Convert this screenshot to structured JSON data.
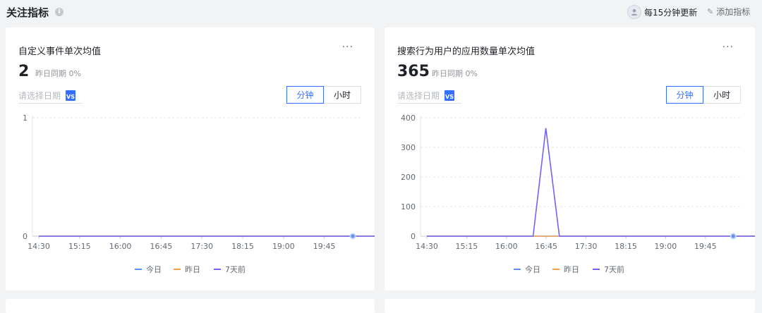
{
  "header": {
    "title": "关注指标",
    "info_icon": "info-icon",
    "refresh_text": "每15分钟更新",
    "add_label": "添加指标"
  },
  "cards": [
    {
      "title": "自定义事件单次均值",
      "value": "2",
      "compare": "昨日同期  0%",
      "date_placeholder": "请选择日期",
      "seg_minute": "分钟",
      "seg_hour": "小时"
    },
    {
      "title": "搜索行为用户的应用数量单次均值",
      "value": "365",
      "compare": "昨日同期  0%",
      "date_placeholder": "请选择日期",
      "seg_minute": "分钟",
      "seg_hour": "小时"
    }
  ],
  "chart_data": [
    {
      "type": "line",
      "title": "",
      "xlabel": "",
      "ylabel": "",
      "x_ticks": [
        "14:30",
        "15:15",
        "16:00",
        "16:45",
        "17:30",
        "18:15",
        "19:00",
        "19:45"
      ],
      "y_ticks": [
        0,
        1
      ],
      "ylim": [
        0,
        1
      ],
      "x": [
        0,
        8.5
      ],
      "grid": true,
      "legend": "bottom",
      "series": [
        {
          "name": "今日",
          "color": "#5b8ff9",
          "values": [
            0,
            0
          ]
        },
        {
          "name": "昨日",
          "color": "#f6a04d",
          "values": [
            0,
            0
          ]
        },
        {
          "name": "7天前",
          "color": "#7262fd",
          "values": [
            0,
            0
          ]
        }
      ],
      "marker": {
        "x": 7.7,
        "y": 0
      }
    },
    {
      "type": "line",
      "title": "",
      "xlabel": "",
      "ylabel": "",
      "x_ticks": [
        "14:30",
        "15:15",
        "16:00",
        "16:45",
        "17:30",
        "18:15",
        "19:00",
        "19:45"
      ],
      "y_ticks": [
        0,
        100,
        200,
        300,
        400
      ],
      "ylim": [
        0,
        400
      ],
      "grid": true,
      "legend": "bottom",
      "series": [
        {
          "name": "今日",
          "color": "#5b8ff9",
          "x": [
            0,
            8.5
          ],
          "values": [
            0,
            0
          ]
        },
        {
          "name": "昨日",
          "color": "#f6a04d",
          "x": [
            0,
            8.5
          ],
          "values": [
            0,
            0
          ]
        },
        {
          "name": "7天前",
          "color": "#7262fd",
          "x": [
            0,
            2.67,
            2.99,
            3.33,
            8.5
          ],
          "values": [
            0,
            0,
            365,
            0,
            0
          ]
        }
      ],
      "marker": {
        "x": 7.7,
        "y": 0
      }
    }
  ]
}
